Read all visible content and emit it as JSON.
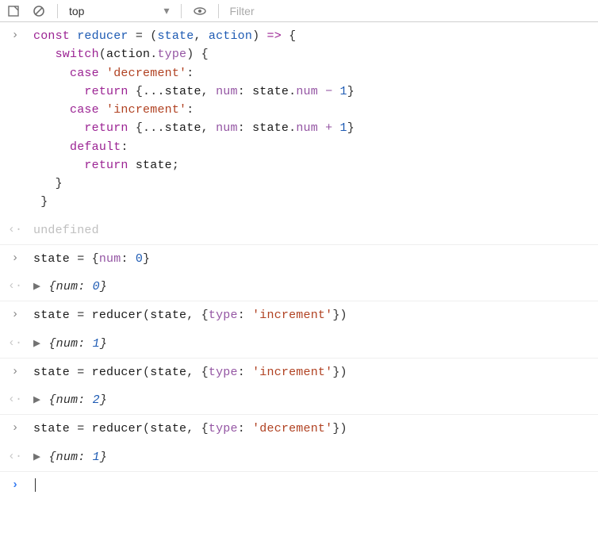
{
  "toolbar": {
    "context_label": "top",
    "filter_placeholder": "Filter"
  },
  "tokens": {
    "const": "const",
    "reducer": "reducer",
    "state": "state",
    "action": "action",
    "switch": "switch",
    "type": "type",
    "case": "case",
    "return": "return",
    "default": "default",
    "num": "num",
    "decrement": "'decrement'",
    "increment": "'increment'",
    "one": "1",
    "zero": "0",
    "two": "2",
    "eq": " = ",
    "arrow": "=>",
    "spread": "...",
    "plus": "+",
    "minus": "−",
    "lbrace": "{",
    "rbrace": "}",
    "lparen": "(",
    "rparen": ")",
    "comma": ", ",
    "colon": ":",
    "semicolon": ";",
    "dot": "."
  },
  "out1": {
    "text": "undefined"
  },
  "in2": {
    "text": "state = {num: 0}"
  },
  "out2": {
    "prefix": "{num: ",
    "value": "0",
    "suffix": "}"
  },
  "in3": {
    "text": "state = reducer(state, {type: 'increment'})"
  },
  "out3": {
    "prefix": "{num: ",
    "value": "1",
    "suffix": "}"
  },
  "in4": {
    "text": "state = reducer(state, {type: 'increment'})"
  },
  "out4": {
    "prefix": "{num: ",
    "value": "2",
    "suffix": "}"
  },
  "in5": {
    "text": "state = reducer(state, {type: 'decrement'})"
  },
  "out5": {
    "prefix": "{num: ",
    "value": "1",
    "suffix": "}"
  }
}
